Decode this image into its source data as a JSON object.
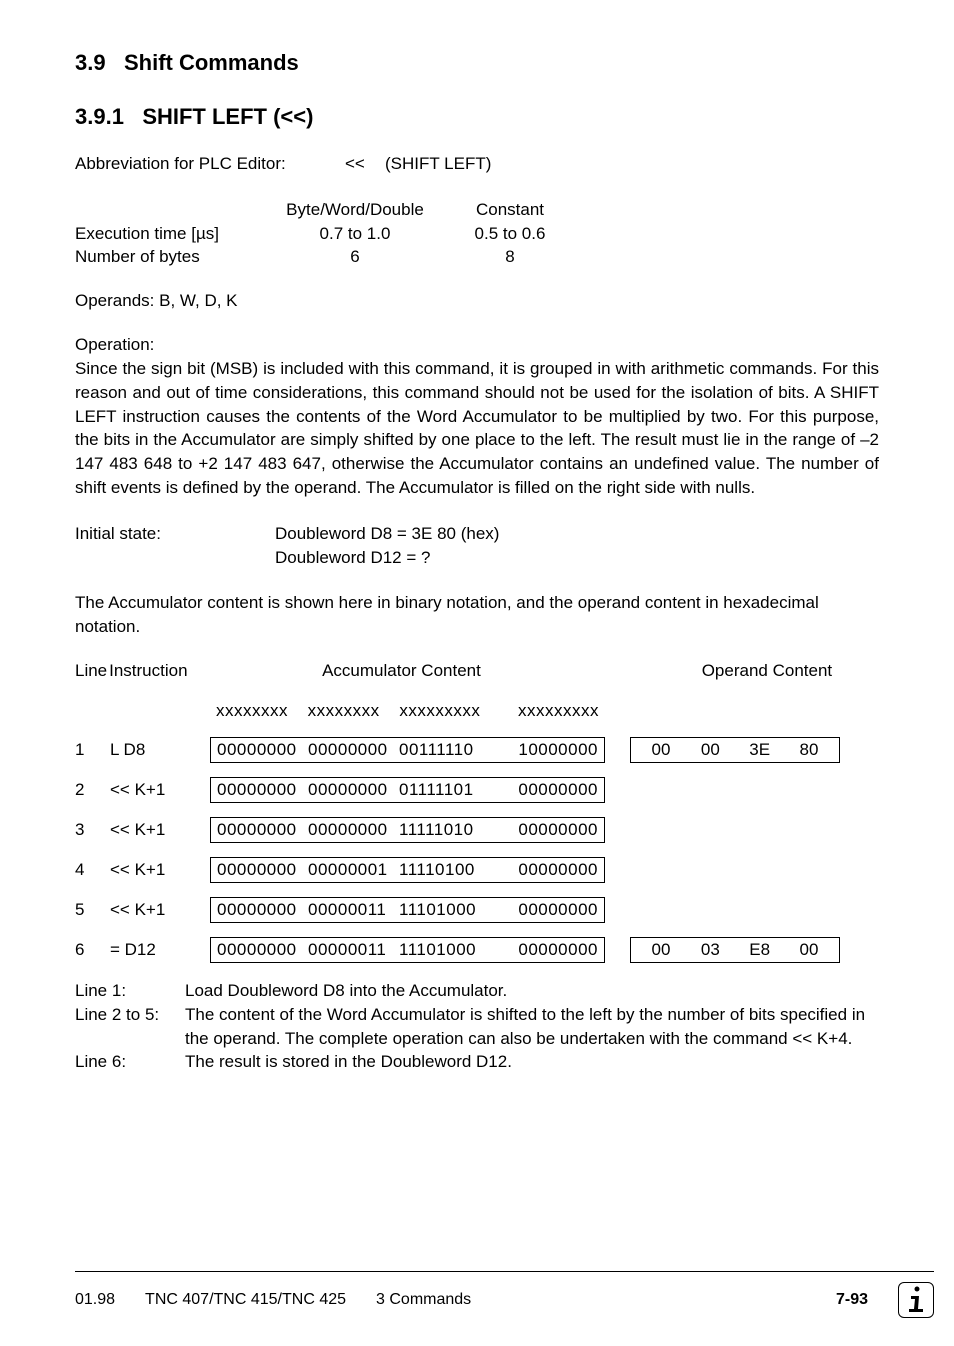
{
  "section": {
    "number": "3.9",
    "title": "Shift Commands"
  },
  "subsection": {
    "number": "3.9.1",
    "title": "SHIFT LEFT   (<<)"
  },
  "abbreviation": {
    "label": "Abbreviation for PLC Editor:",
    "symbol": "<<",
    "name": "(SHIFT LEFT)"
  },
  "timing": {
    "col2_header": "Byte/Word/Double",
    "col3_header": "Constant",
    "rows": [
      {
        "label": "Execution time [µs]",
        "c2": "0.7 to 1.0",
        "c3": "0.5 to 0.6"
      },
      {
        "label": "Number of bytes",
        "c2": "6",
        "c3": "8"
      }
    ]
  },
  "operands": {
    "label": "Operands: B, W, D, K"
  },
  "operation": {
    "label": "Operation:",
    "text": "Since the sign bit (MSB) is included with this command, it is grouped in with arithmetic commands. For this reason and out of time considerations, this command should not be used for the isolation of bits. A SHIFT LEFT instruction causes the contents of the Word Accumulator to be multiplied by two. For this purpose, the bits in the Accumulator are simply shifted by one place to the left. The result must lie in the range of –2 147 483 648 to +2 147  483 647, otherwise the Accumulator contains an undefined value. The number of shift events is defined by the operand. The Accumulator is filled on the right side with nulls."
  },
  "initial": {
    "label": "Initial state:",
    "line1": "Doubleword D8    =  3E 80    (hex)",
    "line2": "Doubleword D12  =  ?"
  },
  "acc_note": "The Accumulator content is shown here in binary notation, and the operand content in hexadecimal notation.",
  "trace": {
    "col_line": "Line",
    "col_instr": "Instruction",
    "col_acc": "Accumulator Content",
    "col_op": "Operand Content",
    "xrow": [
      "xxxxxxxx",
      "xxxxxxxx",
      "xxxxxxxxx",
      "xxxxxxxxx"
    ],
    "rows": [
      {
        "n": "1",
        "instr": "L   D8",
        "acc": [
          "00000000",
          "00000000",
          "00111110",
          "10000000"
        ],
        "op": [
          "00",
          "00",
          "3E",
          "80"
        ]
      },
      {
        "n": "2",
        "instr": "<<  K+1",
        "acc": [
          "00000000",
          "00000000",
          "01111101",
          "00000000"
        ],
        "op": null
      },
      {
        "n": "3",
        "instr": "<<  K+1",
        "acc": [
          "00000000",
          "00000000",
          "11111010",
          "00000000"
        ],
        "op": null
      },
      {
        "n": "4",
        "instr": "<<  K+1",
        "acc": [
          "00000000",
          "00000001",
          "11110100",
          "00000000"
        ],
        "op": null
      },
      {
        "n": "5",
        "instr": "<<  K+1",
        "acc": [
          "00000000",
          "00000011",
          "11101000",
          "00000000"
        ],
        "op": null
      },
      {
        "n": "6",
        "instr": "=   D12",
        "acc": [
          "00000000",
          "00000011",
          "11101000",
          "00000000"
        ],
        "op": [
          "00",
          "03",
          "E8",
          "00"
        ]
      }
    ]
  },
  "explain": [
    {
      "label": "Line 1:",
      "text": "Load Doubleword D8 into the Accumulator."
    },
    {
      "label": "Line 2 to 5:",
      "text": "The content of the Word Accumulator is shifted to the left by the number of bits specified in the operand.   The complete operation can also be undertaken with the command << K+4."
    },
    {
      "label": "Line 6:",
      "text": "The result is stored in the Doubleword D12."
    }
  ],
  "footer": {
    "date": "01.98",
    "doc": "TNC 407/TNC 415/TNC 425",
    "chapter": "3   Commands",
    "page": "7-93"
  }
}
